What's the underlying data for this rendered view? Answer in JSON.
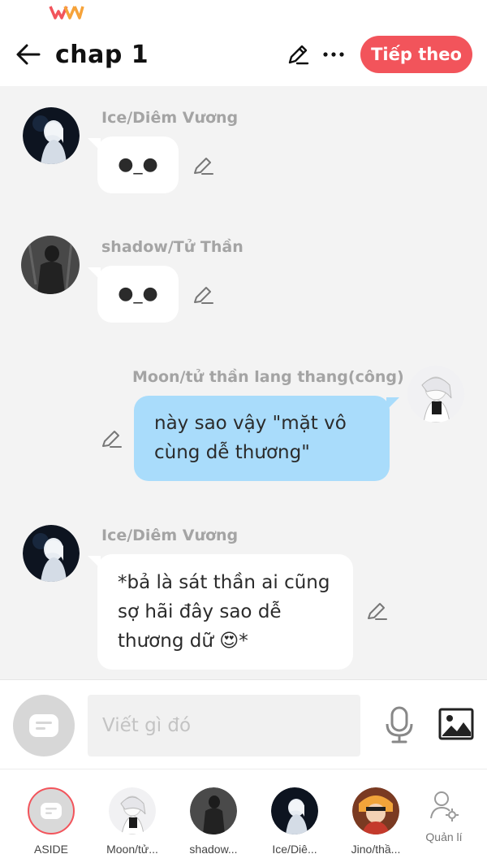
{
  "header": {
    "title": "chap 1",
    "next_label": "Tiếp theo"
  },
  "messages": [
    {
      "author": "Ice/Diêm Vương",
      "text": "●_●",
      "side": "left"
    },
    {
      "author": "shadow/Tử Thần",
      "text": "●_●",
      "side": "left"
    },
    {
      "author": "Moon/tử thần lang thang(công)",
      "text": "này sao vậy \"mặt vô cùng dễ thương\"",
      "side": "right"
    },
    {
      "author": "Ice/Diêm Vương",
      "text": "*bả là sát thần ai cũng sợ hãi đây sao dễ thương dữ 😍*",
      "side": "left"
    }
  ],
  "composer": {
    "placeholder": "Viết gì đó"
  },
  "characters": [
    {
      "label": "ASIDE"
    },
    {
      "label": "Moon/tử..."
    },
    {
      "label": "shadow..."
    },
    {
      "label": "Ice/Diê..."
    },
    {
      "label": "Jino/thầ..."
    },
    {
      "label": "Quản lí"
    }
  ],
  "colors": {
    "accent": "#f2545b",
    "bubble_right": "#a9dcfb",
    "bubble_left": "#ffffff",
    "name_gray": "#a4a4a4"
  },
  "icons": [
    "back-arrow-icon",
    "pencil-icon",
    "more-icon",
    "aside-icon",
    "microphone-icon",
    "image-icon",
    "manage-icon",
    "logo-icon"
  ]
}
